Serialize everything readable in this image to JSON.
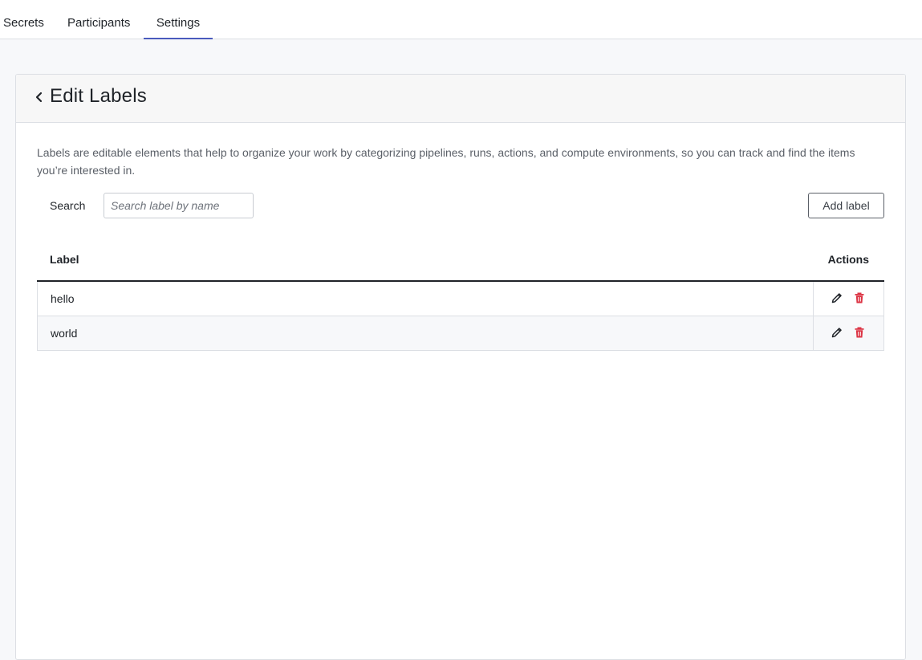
{
  "tabs": [
    {
      "label": "Secrets",
      "active": false
    },
    {
      "label": "Participants",
      "active": false
    },
    {
      "label": "Settings",
      "active": true
    }
  ],
  "page": {
    "title": "Edit Labels",
    "back_icon": "chevron-left-icon",
    "description": "Labels are editable elements that help to organize your work by categorizing pipelines, runs, actions, and compute environments, so you can track and find the items you’re interested in."
  },
  "search": {
    "label": "Search",
    "placeholder": "Search label by name",
    "value": ""
  },
  "toolbar": {
    "add_label": "Add label"
  },
  "table": {
    "columns": [
      "Label",
      "Actions"
    ],
    "rows": [
      {
        "label": "hello",
        "actions": [
          "pencil-icon",
          "trash-icon"
        ]
      },
      {
        "label": "world",
        "actions": [
          "pencil-icon",
          "trash-icon"
        ]
      }
    ]
  },
  "colors": {
    "accent": "#4a5bbd",
    "delete": "#dc3545",
    "edit": "#1f2328"
  }
}
